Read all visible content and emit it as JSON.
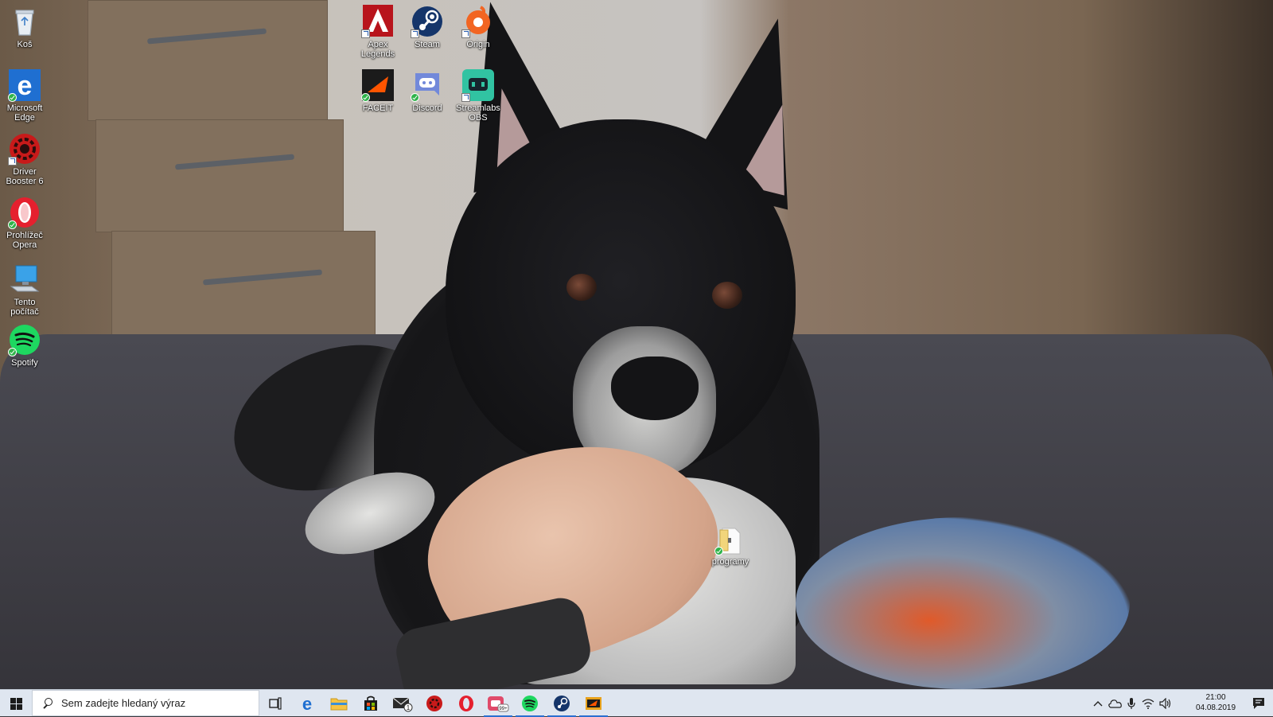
{
  "desktop": {
    "icons": [
      {
        "label": "Koš"
      },
      {
        "label": "Microsoft Edge"
      },
      {
        "label": "Driver Booster 6"
      },
      {
        "label": "Prohlížeč Opera"
      },
      {
        "label": "Tento počítač"
      },
      {
        "label": "Spotify"
      },
      {
        "label": "Apex Legends"
      },
      {
        "label": "Steam"
      },
      {
        "label": "Origin"
      },
      {
        "label": "FACEIT"
      },
      {
        "label": "Discord"
      },
      {
        "label": "Streamlabs OBS"
      },
      {
        "label": "programy"
      }
    ]
  },
  "taskbar": {
    "search_placeholder": "Sem zadejte hledaný výraz",
    "pinned": [
      {
        "icon": "task-view-icon"
      },
      {
        "icon": "edge-icon"
      },
      {
        "icon": "file-explorer-icon"
      },
      {
        "icon": "store-icon"
      },
      {
        "icon": "mail-icon",
        "badge": "1"
      },
      {
        "icon": "driver-booster-icon"
      },
      {
        "icon": "opera-icon"
      },
      {
        "icon": "streamlabs-icon",
        "badge": "99+"
      },
      {
        "icon": "spotify-icon"
      },
      {
        "icon": "steam-icon"
      },
      {
        "icon": "faceit-icon"
      }
    ],
    "clock": {
      "time": "21:00",
      "date": "04.08.2019"
    }
  },
  "colors": {
    "taskbar_bg": "#dfe6f0",
    "accent": "#2b6fd0",
    "check_badge": "#2fb34a"
  }
}
